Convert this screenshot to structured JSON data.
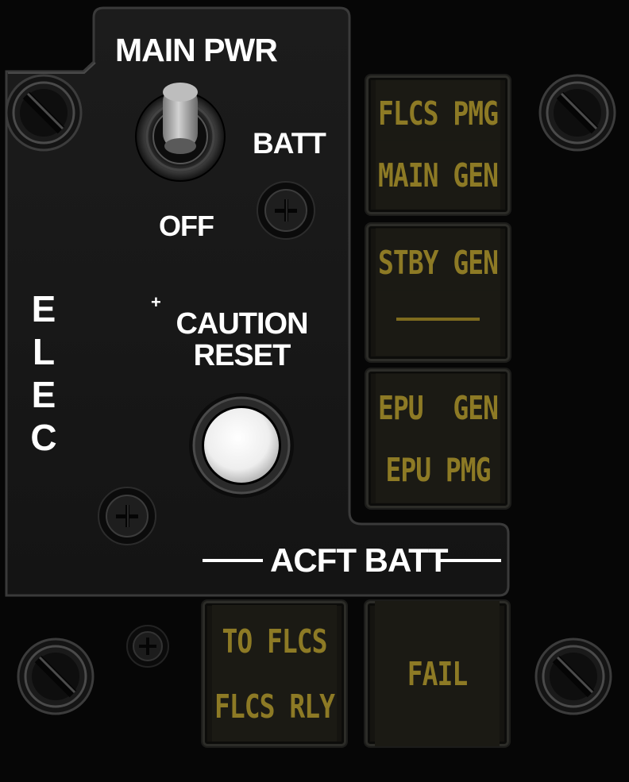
{
  "panel": {
    "side_label": "ELEC",
    "main_pwr": {
      "title": "MAIN PWR",
      "position_batt": "BATT",
      "position_off": "OFF"
    },
    "caution_reset": {
      "marker": "+",
      "line1": "CAUTION",
      "line2": "RESET"
    },
    "acft_batt_label": "ACFT BATT",
    "annunciators": {
      "flcs_pmg": "FLCS PMG",
      "main_gen": "MAIN GEN",
      "stby_gen": "STBY GEN",
      "epu_gen": "EPU  GEN",
      "epu_pmg": "EPU PMG",
      "to_flcs": "TO FLCS",
      "flcs_rly": "FLCS RLY",
      "fail": "FAIL"
    },
    "colors": {
      "annunciator_text": "#8d7a25",
      "label_text": "#ffffff",
      "plate": "#181818"
    }
  }
}
